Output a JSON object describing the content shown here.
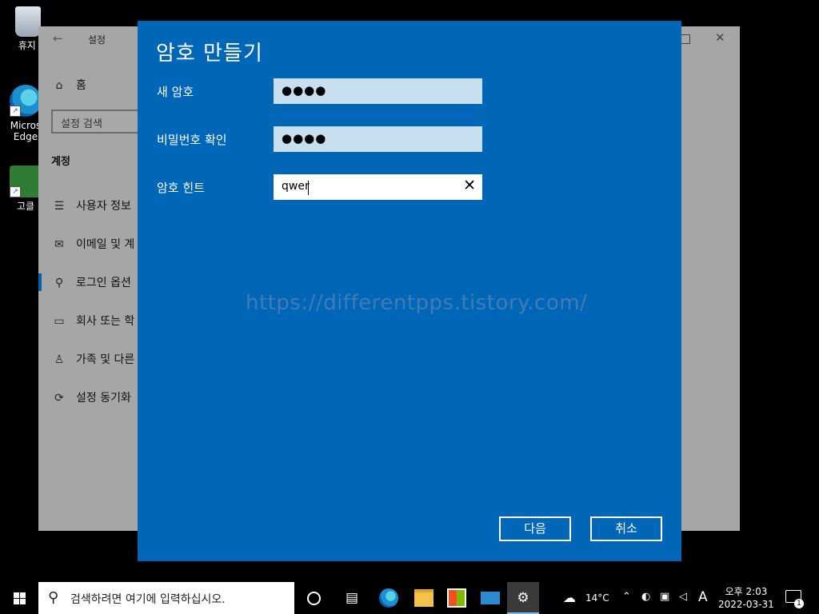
{
  "desktop": {
    "icons": [
      {
        "label": "휴지통",
        "icon": "recycle-bin-icon"
      },
      {
        "label": "Microsoft Edge",
        "icon": "edge-icon"
      },
      {
        "label": "고클",
        "icon": "goclean-icon"
      }
    ],
    "label_visible": {
      "recycle": "휴지 ",
      "edge_line1": "Micros",
      "edge_line2": "Edge",
      "google": "고클"
    }
  },
  "settings_window": {
    "title": "설정",
    "home_label": "홈",
    "search_placeholder": "설정 검색",
    "section_title": "계정",
    "nav_items": [
      {
        "label": "사용자 정보",
        "icon": "person-card-icon"
      },
      {
        "label": "이메일 및 계",
        "icon": "mail-icon"
      },
      {
        "label": "로그인 옵션",
        "icon": "key-icon"
      },
      {
        "label": "회사 또는 학",
        "icon": "briefcase-icon"
      },
      {
        "label": "가족 및 다른",
        "icon": "person-add-icon"
      },
      {
        "label": "설정 동기화",
        "icon": "sync-icon"
      }
    ]
  },
  "dialog": {
    "title": "암호 만들기",
    "fields": [
      {
        "label": "새 암호",
        "value": "●●●●",
        "type": "password"
      },
      {
        "label": "비밀번호 확인",
        "value": "●●●●",
        "type": "password"
      },
      {
        "label": "암호 힌트",
        "value": "qwer",
        "type": "text"
      }
    ],
    "watermark": "https://differentpps.tistory.com/",
    "next_button": "다음",
    "cancel_button": "취소"
  },
  "taskbar": {
    "search_placeholder": "검색하려면 여기에 입력하십시오.",
    "pinned_apps": [
      "cortana-icon",
      "task-view-icon",
      "edge-icon",
      "file-explorer-icon",
      "store-icon",
      "mail-icon",
      "settings-icon"
    ],
    "active_app": "settings-icon",
    "weather": "14°C",
    "ime": "A",
    "time": "오후 2:03",
    "date": "2022-03-31",
    "notification_count": "1"
  },
  "colors": {
    "dialog_bg": "#0067b8",
    "settings_bg": "#a6a6a6",
    "accent": "#0063b1"
  }
}
